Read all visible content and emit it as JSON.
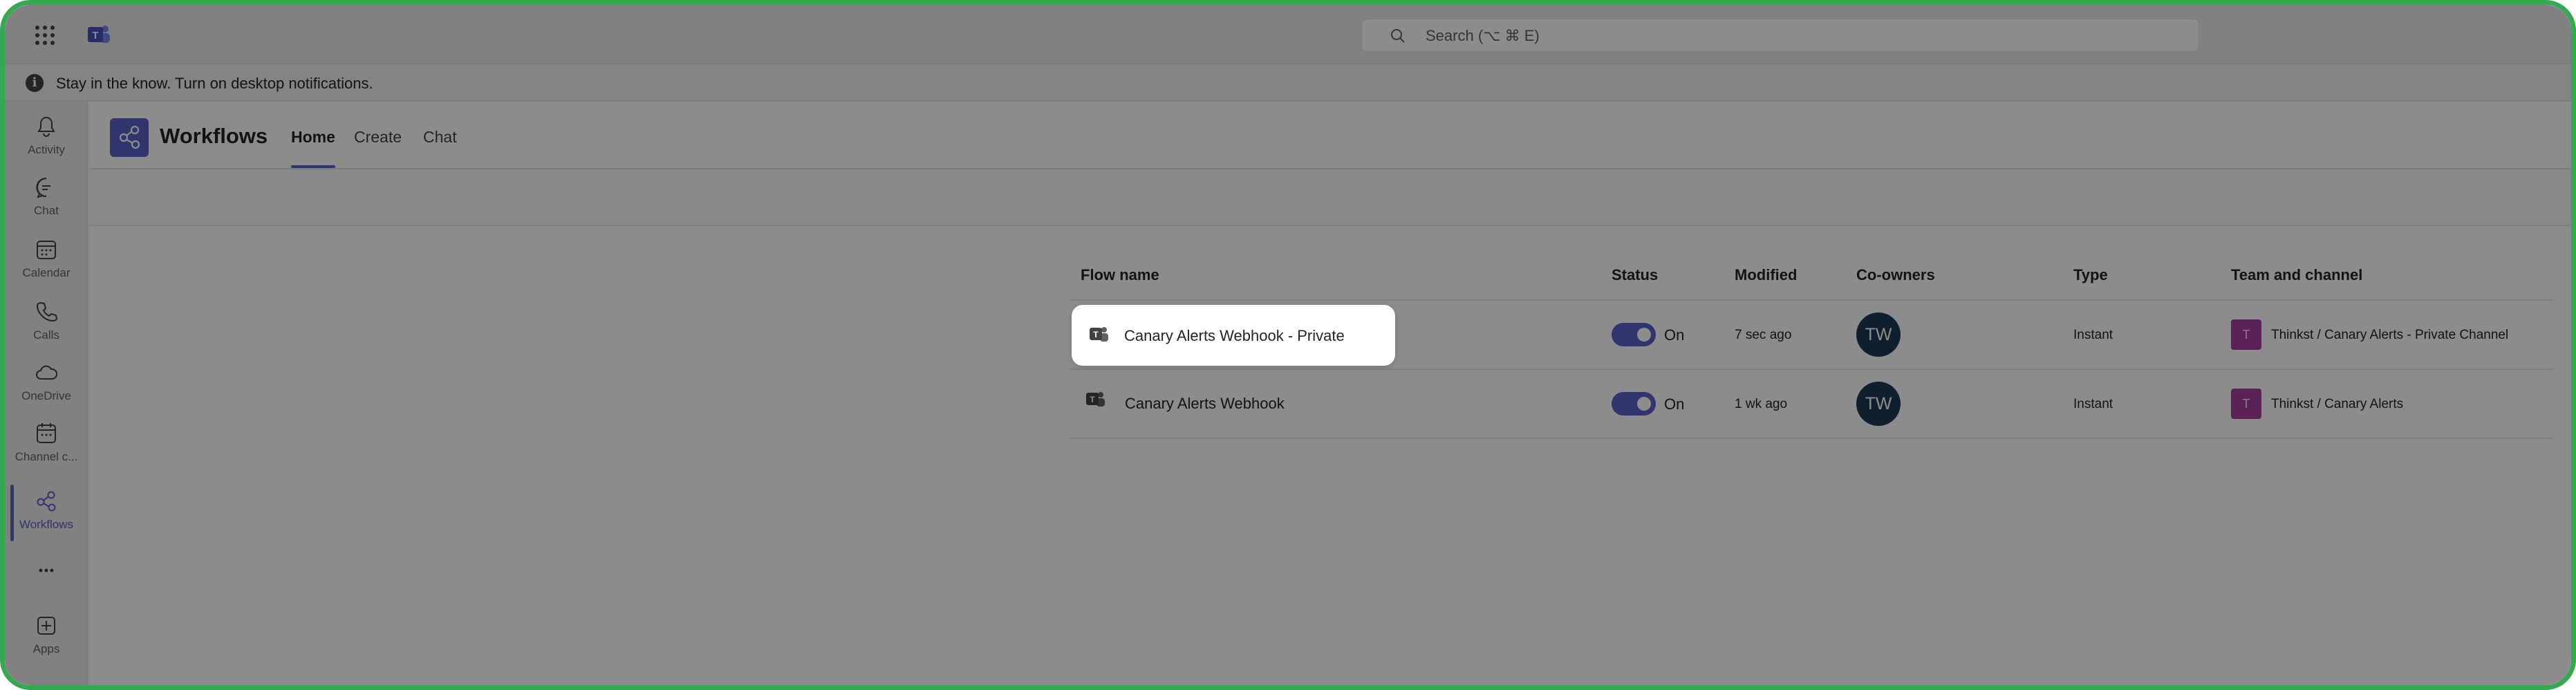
{
  "topbar": {
    "app_launcher_icon": "waffle-icon",
    "logo_icon": "teams-logo-icon",
    "search": {
      "placeholder": "Search (⌥ ⌘ E)",
      "icon": "search-icon"
    }
  },
  "notice": {
    "icon": "info-icon",
    "text": "Stay in the know. Turn on desktop notifications."
  },
  "rail": {
    "items": [
      {
        "label": "Activity",
        "icon": "bell-icon"
      },
      {
        "label": "Chat",
        "icon": "chat-icon"
      },
      {
        "label": "Calendar",
        "icon": "calendar-icon"
      },
      {
        "label": "Calls",
        "icon": "phone-icon"
      },
      {
        "label": "OneDrive",
        "icon": "cloud-icon"
      },
      {
        "label": "Channel c...",
        "icon": "channel-calendar-icon"
      },
      {
        "label": "Workflows",
        "icon": "workflows-icon",
        "active": true
      },
      {
        "label": "",
        "icon": "more-icon"
      },
      {
        "label": "Apps",
        "icon": "add-app-icon"
      }
    ]
  },
  "app": {
    "title": "Workflows",
    "icon": "workflows-icon",
    "tabs": [
      {
        "label": "Home",
        "active": true
      },
      {
        "label": "Create"
      },
      {
        "label": "Chat"
      }
    ]
  },
  "table": {
    "columns": [
      "Flow name",
      "Status",
      "Modified",
      "Co-owners",
      "Type",
      "Team and channel"
    ],
    "rows": [
      {
        "name": "Canary Alerts Webhook - Private",
        "status": "On",
        "modified": "7 sec ago",
        "coowner": "TW",
        "type": "Instant",
        "team_initial": "T",
        "team_channel": "Thinkst / Canary Alerts - Private Channel"
      },
      {
        "name": "Canary Alerts Webhook",
        "status": "On",
        "modified": "1 wk ago",
        "coowner": "TW",
        "type": "Instant",
        "team_initial": "T",
        "team_channel": "Thinkst / Canary Alerts"
      }
    ]
  },
  "colors": {
    "accent": "#5b5fc7",
    "frame": "#35a852",
    "avatar": "#1e3a54",
    "team_badge": "#a73ea1"
  }
}
